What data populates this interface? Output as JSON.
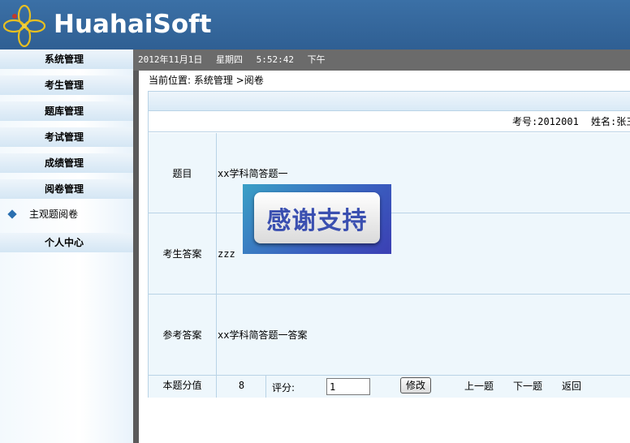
{
  "header": {
    "logo_text": "HuahaiSoft"
  },
  "sidebar": {
    "menus": [
      {
        "label": "系统管理"
      },
      {
        "label": "考生管理"
      },
      {
        "label": "题库管理"
      },
      {
        "label": "考试管理"
      },
      {
        "label": "成绩管理"
      },
      {
        "label": "阅卷管理"
      }
    ],
    "sub_item": "主观题阅卷",
    "personal_center": "个人中心"
  },
  "topbar": {
    "date": "2012年11月1日",
    "weekday": "星期四",
    "time": "5:52:42",
    "period": "下午"
  },
  "breadcrumb": "当前位置: 系统管理 >阅卷",
  "student": {
    "id_text": "考号:2012001",
    "name_text": "姓名:张三"
  },
  "question": {
    "title_label": "题目",
    "title_value": "xx学科简答题一",
    "answer_label": "考生答案",
    "answer_value": "zzz",
    "reference_label": "参考答案",
    "reference_value": "xx学科简答题一答案"
  },
  "scoring": {
    "score_label": "本题分值",
    "score_value": "8",
    "rate_label": "评分:",
    "rate_input": "1",
    "modify_button": "修改",
    "prev": "上一题",
    "next": "下一题",
    "back": "返回"
  },
  "overlay": {
    "text": "感谢支持"
  },
  "colors": {
    "header_bg": "#336699",
    "topbar_bg": "#6b6b6b",
    "accent": "#2a6fb0"
  }
}
